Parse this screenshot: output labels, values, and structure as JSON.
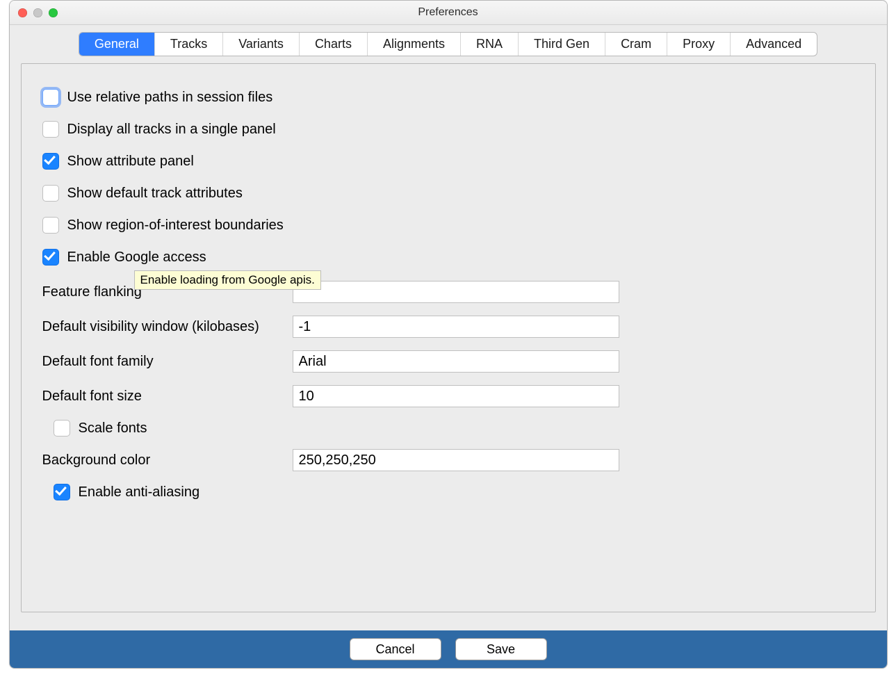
{
  "window": {
    "title": "Preferences"
  },
  "tabs": [
    "General",
    "Tracks",
    "Variants",
    "Charts",
    "Alignments",
    "RNA",
    "Third Gen",
    "Cram",
    "Proxy",
    "Advanced"
  ],
  "activeTab": 0,
  "checkboxes": {
    "relativePaths": {
      "label": "Use relative paths in session files",
      "checked": false,
      "focused": true
    },
    "singlePanel": {
      "label": "Display all tracks in a single panel",
      "checked": false
    },
    "attrPanel": {
      "label": "Show attribute panel",
      "checked": true
    },
    "defaultAttrs": {
      "label": "Show default track attributes",
      "checked": false
    },
    "roiBoundaries": {
      "label": "Show region-of-interest boundaries",
      "checked": false
    },
    "googleAccess": {
      "label": "Enable Google access",
      "checked": true
    },
    "scaleFonts": {
      "label": "Scale fonts",
      "checked": false
    },
    "antiAliasing": {
      "label": "Enable anti-aliasing",
      "checked": true
    }
  },
  "fields": {
    "flanking": {
      "label": "Feature flanking",
      "value": ""
    },
    "visWindow": {
      "label": "Default visibility window (kilobases)",
      "value": "-1"
    },
    "fontFamily": {
      "label": "Default font family",
      "value": "Arial"
    },
    "fontSize": {
      "label": "Default font size",
      "value": "10"
    },
    "bgColor": {
      "label": "Background color",
      "value": "250,250,250"
    }
  },
  "tooltip": "Enable loading from Google apis.",
  "footer": {
    "cancel": "Cancel",
    "save": "Save"
  }
}
